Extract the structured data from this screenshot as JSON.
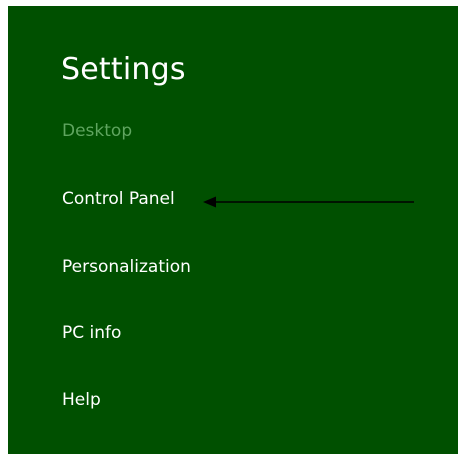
{
  "panel": {
    "title": "Settings",
    "subtitle": "Desktop",
    "background_color": "#005000",
    "subtitle_color": "#5fa55f"
  },
  "menu": {
    "items": [
      {
        "label": "Control Panel"
      },
      {
        "label": "Personalization"
      },
      {
        "label": "PC info"
      },
      {
        "label": "Help"
      }
    ]
  },
  "annotation": {
    "arrow_color": "#000000",
    "points_to": "Control Panel"
  }
}
